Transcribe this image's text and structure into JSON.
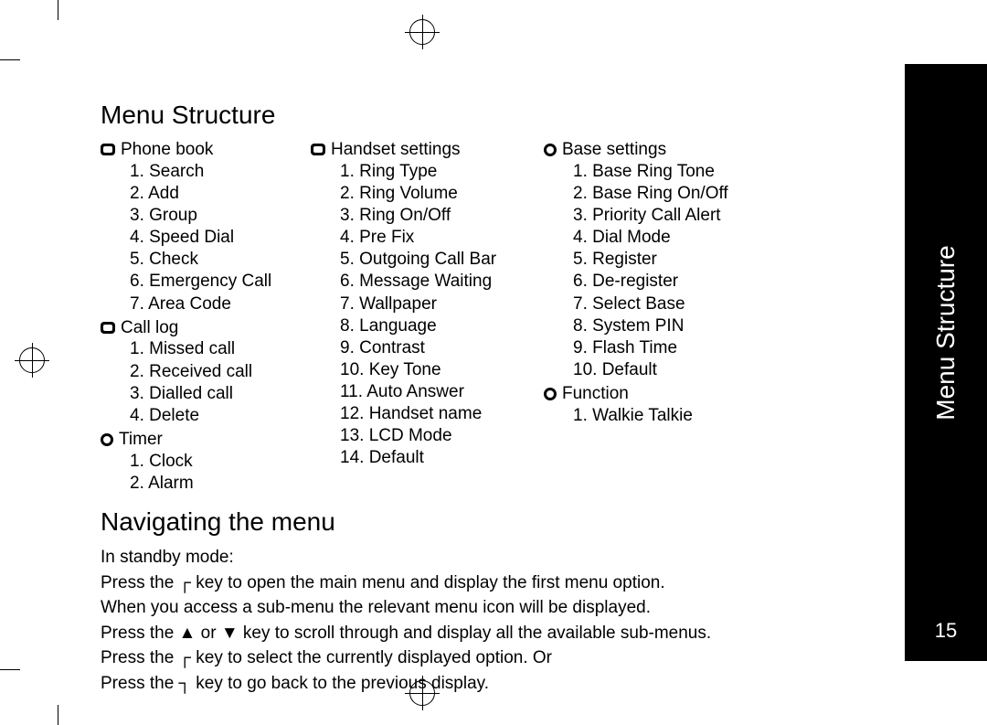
{
  "heading1": "Menu Structure",
  "heading2": "Navigating the menu",
  "sidebar_label": "Menu Structure",
  "page_number": "15",
  "columns": [
    {
      "groups": [
        {
          "icon": "rect",
          "title": "Phone book",
          "items": [
            "Search",
            "Add",
            "Group",
            "Speed Dial",
            "Check",
            "Emergency Call",
            " Area Code"
          ]
        },
        {
          "icon": "rect",
          "title": "Call log",
          "items": [
            "Missed call",
            "Received call",
            "Dialled call",
            "Delete"
          ]
        },
        {
          "icon": "circle",
          "title": "Timer",
          "items": [
            "Clock",
            "Alarm"
          ]
        }
      ]
    },
    {
      "groups": [
        {
          "icon": "rect",
          "title": "Handset settings",
          "items": [
            "Ring Type",
            "Ring Volume",
            "Ring On/Off",
            "Pre Fix",
            "Outgoing Call Bar",
            "Message Waiting",
            "Wallpaper",
            "Language",
            "Contrast",
            "Key Tone",
            "Auto Answer",
            "Handset name",
            "LCD Mode",
            "Default"
          ]
        }
      ]
    },
    {
      "groups": [
        {
          "icon": "circle",
          "title": "Base settings",
          "items": [
            "Base Ring Tone",
            "Base Ring On/Off",
            "Priority Call Alert",
            "Dial Mode",
            "Register",
            "De-register",
            "Select Base",
            "System PIN",
            "Flash Time",
            "Default"
          ]
        },
        {
          "icon": "circle",
          "title": "Function",
          "items": [
            "Walkie Talkie"
          ]
        }
      ]
    }
  ],
  "nav": {
    "line0": "In standby mode:",
    "line1a": "Press the ",
    "key_open": "┌",
    "line1b": " key to open the main menu and display the first menu option.",
    "line2": "When you access a sub-menu the relevant menu icon will be displayed.",
    "line3a": "Press the ",
    "key_up": "▲",
    "line3b": " or ",
    "key_down": "▼",
    "line3c": " key to scroll through and display all the available sub-menus.",
    "line4a": "Press the  ",
    "key_select": "┌",
    "line4b": "  key to select the currently displayed option. Or",
    "line5a": "Press the  ",
    "key_back": "┐",
    "line5b": "  key to go back to the previous display."
  }
}
